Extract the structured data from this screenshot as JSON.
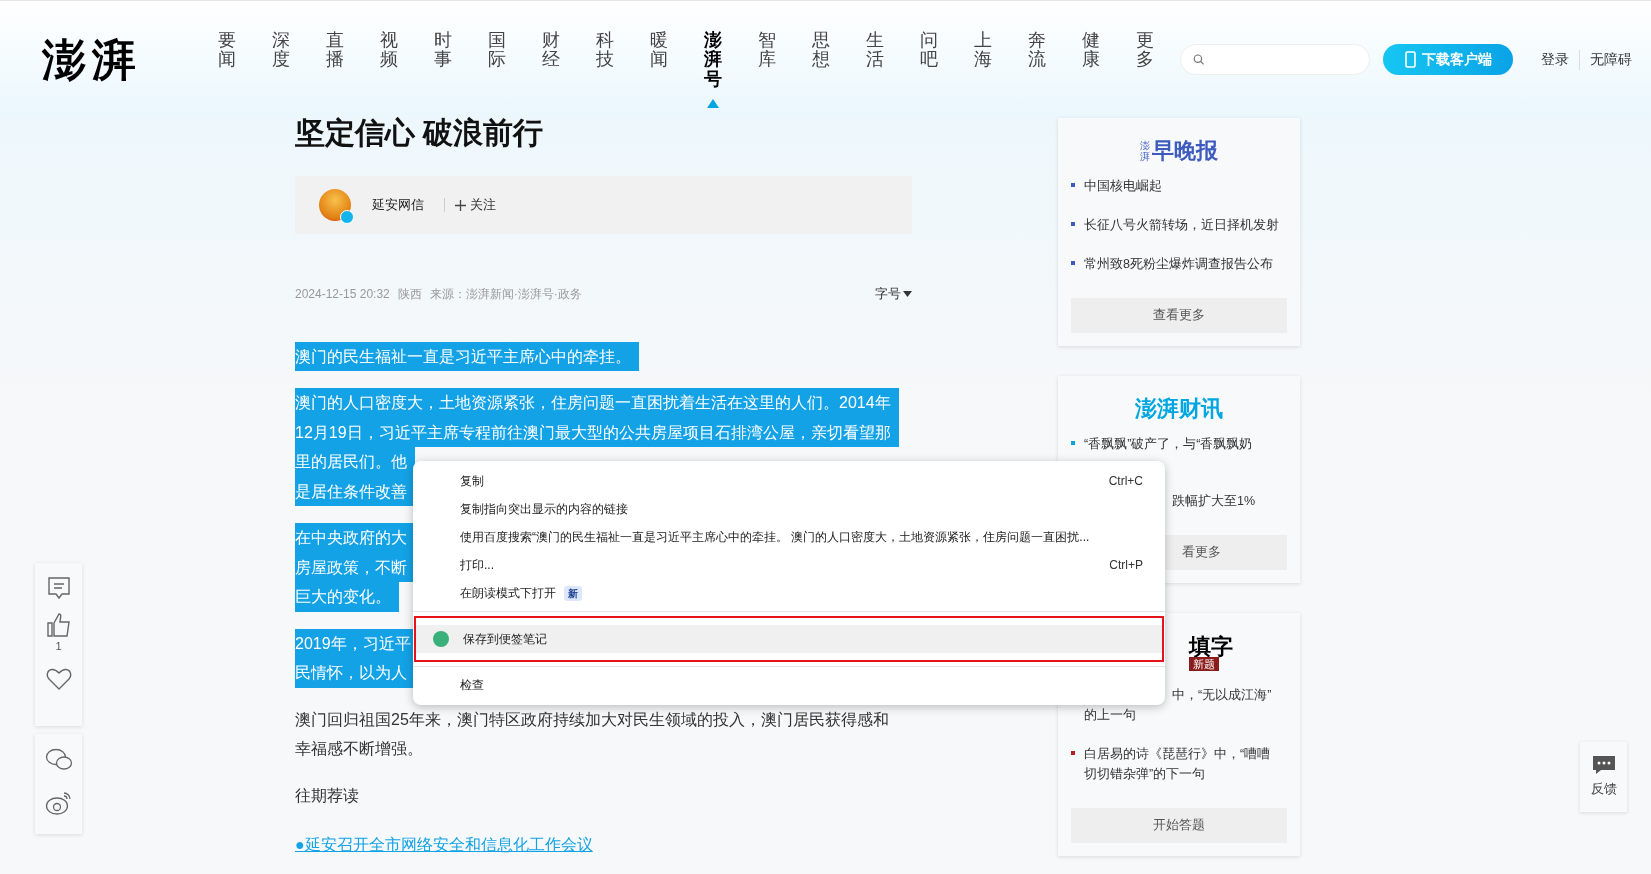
{
  "header": {
    "logo": "澎湃",
    "nav": [
      {
        "label": "要闻",
        "selected": false
      },
      {
        "label": "深度",
        "selected": false
      },
      {
        "label": "直播",
        "selected": false
      },
      {
        "label": "视频",
        "selected": false
      },
      {
        "label": "时事",
        "selected": false
      },
      {
        "label": "国际",
        "selected": false
      },
      {
        "label": "财经",
        "selected": false
      },
      {
        "label": "科技",
        "selected": false
      },
      {
        "label": "暖闻",
        "selected": false
      },
      {
        "label": "澎湃号",
        "selected": true
      },
      {
        "label": "智库",
        "selected": false
      },
      {
        "label": "思想",
        "selected": false
      },
      {
        "label": "生活",
        "selected": false
      },
      {
        "label": "问吧",
        "selected": false
      },
      {
        "label": "上海",
        "selected": false
      },
      {
        "label": "奔流",
        "selected": false
      },
      {
        "label": "健康",
        "selected": false
      },
      {
        "label": "更多",
        "selected": false
      }
    ],
    "download_button": "下载客户端",
    "login": "登录",
    "accessibility": "无障碍"
  },
  "article": {
    "title": "坚定信心 破浪前行",
    "author": {
      "name": "延安网信",
      "verified": true,
      "follow": "关注"
    },
    "meta": {
      "date": "2024-12-15 20:32",
      "region": "陕西",
      "source": "来源：澎湃新闻·澎湃号·政务",
      "font_size": "字号"
    },
    "paragraphs": [
      {
        "selected": true,
        "lines": [
          "澳门的民生福祉一直是习近平主席心中的牵挂。"
        ]
      },
      {
        "selected": true,
        "lines": [
          "澳门的人口密度大，土地资源紧张，住房问题一直困扰着生活在这里的人们。2014年",
          "12月19日，习近平主席专程前往澳门最大型的公共房屋项目石排湾公屋，亲切看望那",
          "里的居民们。他",
          "是居住条件改善"
        ]
      },
      {
        "selected": true,
        "lines": [
          "在中央政府的大",
          "房屋政策，不断",
          "巨大的变化。"
        ]
      },
      {
        "selected": true,
        "lines": [
          "2019年，习近平",
          "民情怀，以为人"
        ]
      },
      {
        "selected": false,
        "lines": [
          "澳门回归祖国25年来，澳门特区政府持续加大对民生领域的投入，澳门居民获得感和",
          "幸福感不断增强。"
        ]
      },
      {
        "selected": false,
        "lines": [
          "往期荐读"
        ]
      }
    ],
    "link": "●延安召开全市网络安全和信息化工作会议"
  },
  "actions": {
    "like_count": "1"
  },
  "sidebar": [
    {
      "logo_small": "澎湃",
      "logo": "早晚报",
      "covered": false,
      "color": "#3d5bbf",
      "items": [
        {
          "kind": "full",
          "lines": [
            "中国核电崛起"
          ]
        },
        {
          "kind": "full",
          "lines": [
            "长征八号火箭转场，近日择机发射"
          ]
        },
        {
          "kind": "full",
          "lines": [
            "常州致8死粉尘爆炸调查报告公布"
          ]
        }
      ],
      "button": {
        "label": "查看更多",
        "covered": false
      }
    },
    {
      "logo": "澎湃财讯",
      "covered": false,
      "color": "#00a6e0",
      "items": [
        {
          "kind": "full",
          "lines": [
            "“香飘飘”破产了，与“香飘飘奶"
          ]
        },
        {
          "kind": "partial",
          "lines": [
            "跌幅扩大至1%"
          ]
        }
      ],
      "button": {
        "label": "看更多",
        "covered": true
      }
    },
    {
      "logo": "填字",
      "subtitle": "新题",
      "covered": true,
      "color": "#b22222",
      "items": [
        {
          "kind": "partial",
          "lines": [
            "中，“无以成江海”",
            "的上一句"
          ]
        },
        {
          "kind": "full",
          "lines": [
            "白居易的诗《琵琶行》中，“嘈嘈",
            "切切错杂弹”的下一句"
          ]
        }
      ],
      "button": {
        "label": "开始答题",
        "covered": false
      }
    }
  ],
  "context_menu": [
    {
      "kind": "item",
      "label": "复制",
      "shortcut": "Ctrl+C",
      "selected": false
    },
    {
      "kind": "item",
      "label": "复制指向突出显示的内容的链接",
      "selected": false
    },
    {
      "kind": "item",
      "label": "使用百度搜索“澳门的民生福祉一直是习近平主席心中的牵挂。 澳门的人口密度大，土地资源紧张，住房问题一直困扰...",
      "selected": false
    },
    {
      "kind": "item",
      "label": "打印...",
      "shortcut": "Ctrl+P",
      "selected": false
    },
    {
      "kind": "item",
      "label": "在朗读模式下打开",
      "badge": "新",
      "selected": false
    },
    {
      "kind": "separator"
    },
    {
      "kind": "item",
      "label": "保存到便签笔记",
      "icon": true,
      "outlined": true,
      "selected": true
    },
    {
      "kind": "separator"
    },
    {
      "kind": "item",
      "label": "检查",
      "selected": false
    }
  ],
  "feedback": "反馈"
}
